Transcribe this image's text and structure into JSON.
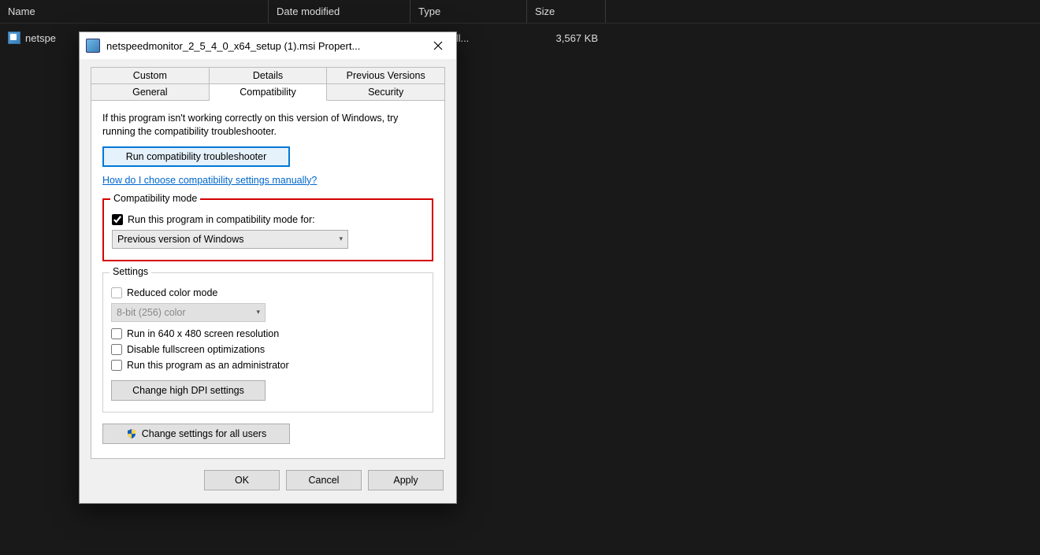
{
  "explorer": {
    "columns": {
      "name": "Name",
      "date": "Date modified",
      "type": "Type",
      "size": "Size"
    },
    "row": {
      "name_visible": "netspe",
      "type": "ws Install...",
      "size": "3,567 KB"
    }
  },
  "dialog": {
    "title": "netspeedmonitor_2_5_4_0_x64_setup (1).msi Propert...",
    "tabs_row1": [
      "Custom",
      "Details",
      "Previous Versions"
    ],
    "tabs_row2": [
      "General",
      "Compatibility",
      "Security"
    ],
    "active_tab": "Compatibility",
    "help_text": "If this program isn't working correctly on this version of Windows, try running the compatibility troubleshooter.",
    "run_troubleshooter": "Run compatibility troubleshooter",
    "help_link": "How do I choose compatibility settings manually?",
    "compat_mode": {
      "legend": "Compatibility mode",
      "checkbox_label": "Run this program in compatibility mode for:",
      "checkbox_checked": true,
      "select_value": "Previous version of Windows"
    },
    "settings": {
      "legend": "Settings",
      "reduced_color": "Reduced color mode",
      "color_select": "8-bit (256) color",
      "run_640": "Run in 640 x 480 screen resolution",
      "disable_fullscreen": "Disable fullscreen optimizations",
      "run_admin": "Run this program as an administrator",
      "high_dpi": "Change high DPI settings"
    },
    "change_all_users": "Change settings for all users",
    "buttons": {
      "ok": "OK",
      "cancel": "Cancel",
      "apply": "Apply"
    }
  }
}
